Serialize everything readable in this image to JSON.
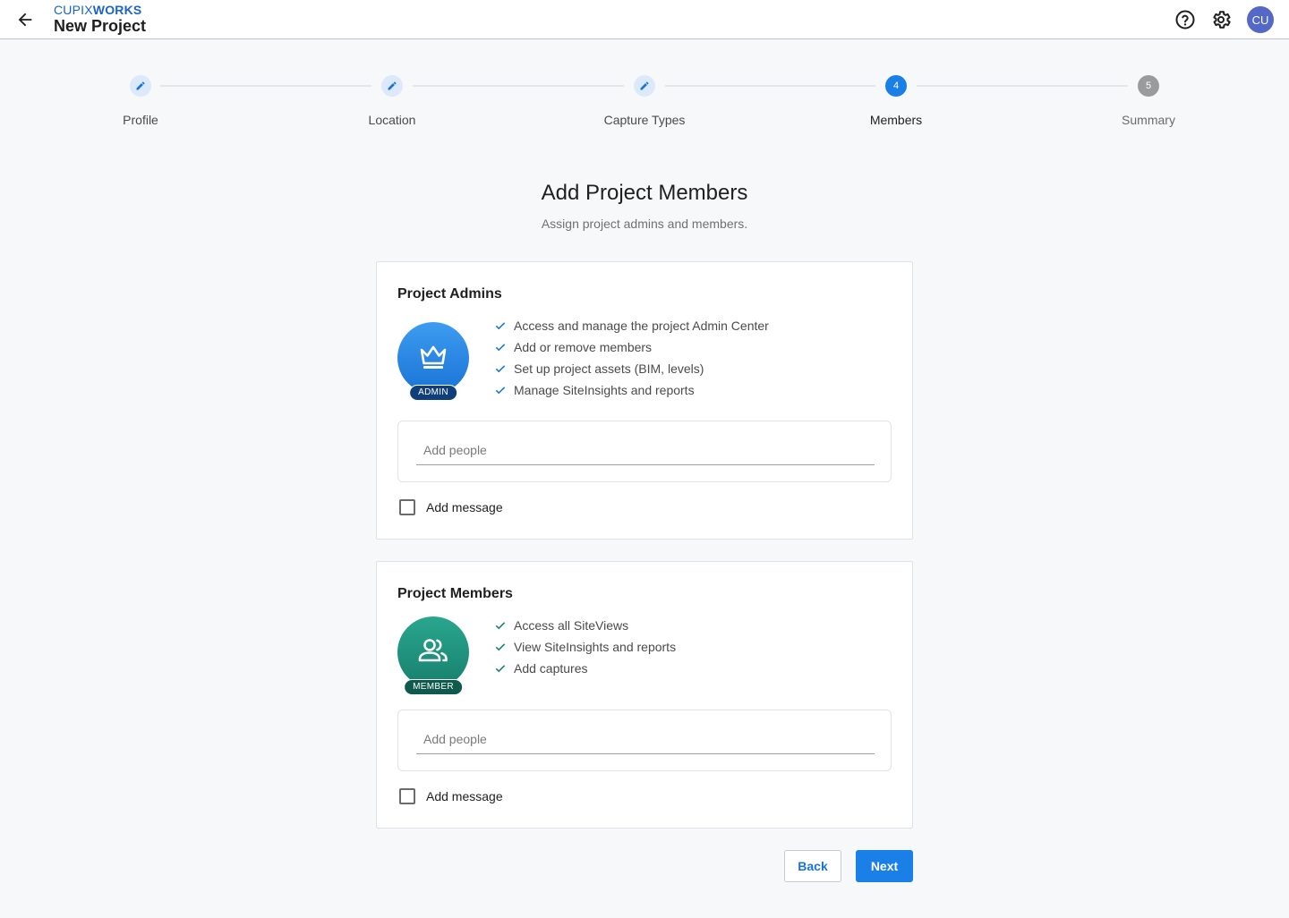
{
  "header": {
    "brand_light": "CUPIX",
    "brand_bold": "WORKS",
    "title": "New Project",
    "avatar_initials": "CU"
  },
  "stepper": {
    "steps": [
      {
        "label": "Profile",
        "state": "done",
        "number": ""
      },
      {
        "label": "Location",
        "state": "done",
        "number": ""
      },
      {
        "label": "Capture Types",
        "state": "done",
        "number": ""
      },
      {
        "label": "Members",
        "state": "active",
        "number": "4"
      },
      {
        "label": "Summary",
        "state": "todo",
        "number": "5"
      }
    ]
  },
  "page": {
    "title": "Add Project Members",
    "subtitle": "Assign project admins and members."
  },
  "admins": {
    "title": "Project Admins",
    "badge": "ADMIN",
    "permissions": [
      "Access and manage the project Admin Center",
      "Add or remove members",
      "Set up project assets (BIM, levels)",
      "Manage SiteInsights and reports"
    ],
    "people_placeholder": "Add people",
    "add_message_label": "Add message"
  },
  "members": {
    "title": "Project Members",
    "badge": "MEMBER",
    "permissions": [
      "Access all SiteViews",
      "View SiteInsights and reports",
      "Add captures"
    ],
    "people_placeholder": "Add people",
    "add_message_label": "Add message"
  },
  "footer": {
    "back_label": "Back",
    "next_label": "Next"
  },
  "colors": {
    "accent": "#1a7fe6",
    "admin_badge": "#1a73d6",
    "member_badge": "#17806d",
    "check_admin": "#1a73d6",
    "check_member": "#17806d"
  },
  "icons": {
    "back": "arrow-left-icon",
    "help": "help-circle-icon",
    "settings": "gear-icon",
    "step_done": "pencil-icon",
    "admin": "crown-icon",
    "member": "people-icon",
    "permission": "check-icon"
  }
}
